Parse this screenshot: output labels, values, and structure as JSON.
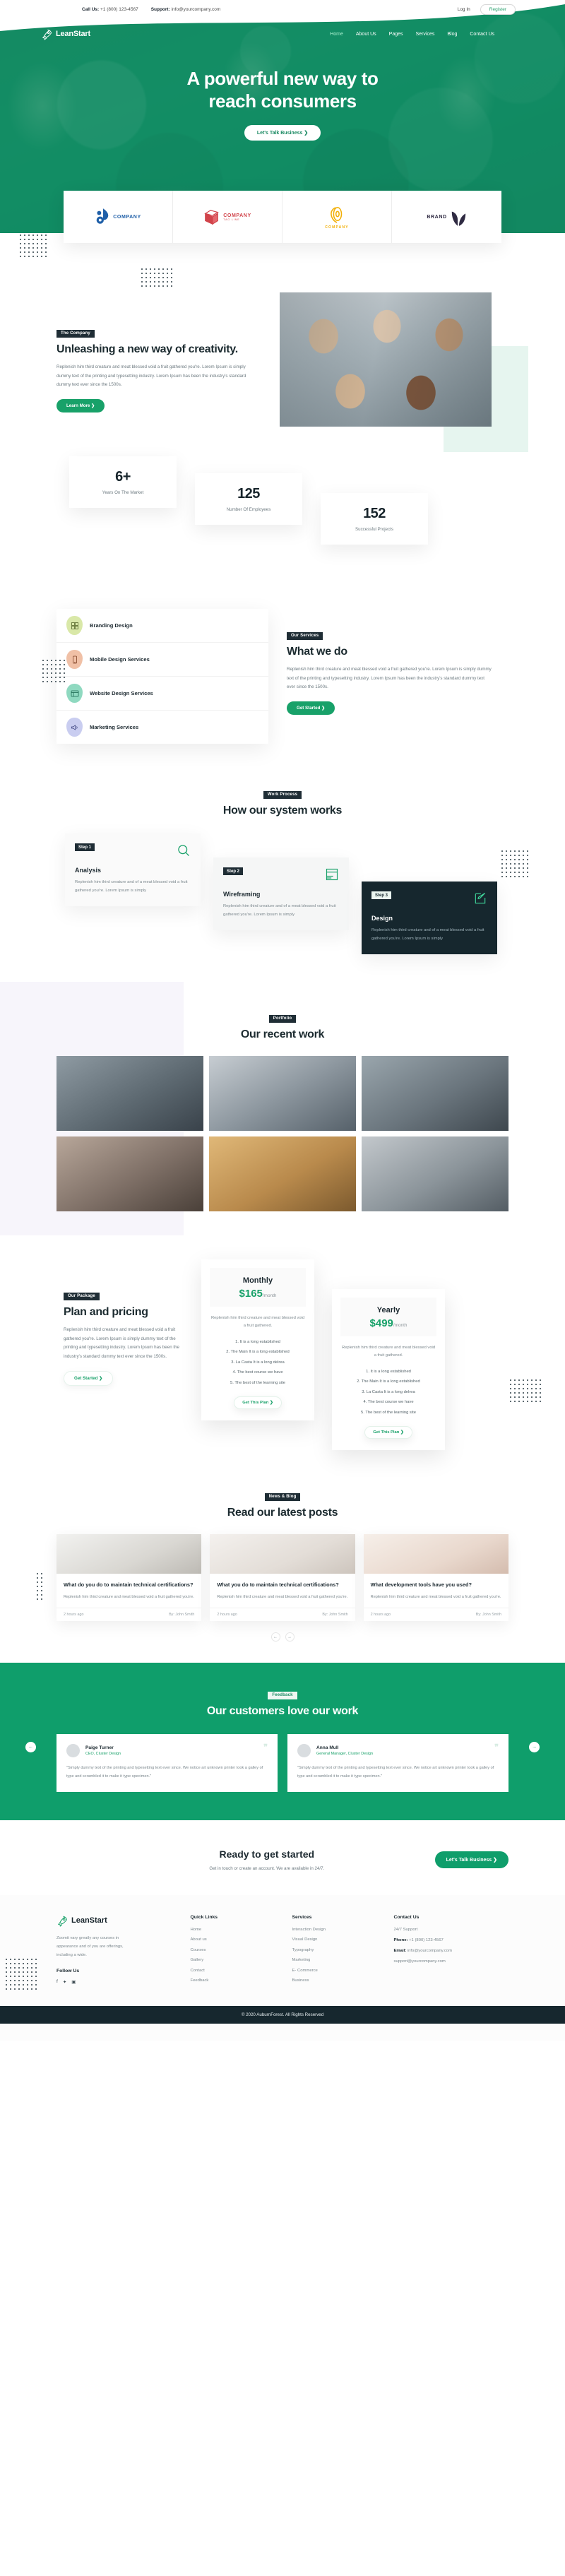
{
  "topbar": {
    "call_label": "Call Us:",
    "phone": "+1 (800) 123-4567",
    "support_label": "Support:",
    "email": "info@yourcompany.com",
    "login": "Log In",
    "register": "Register"
  },
  "brand": {
    "name": "LeanStart",
    "icon": "rocket-icon"
  },
  "nav": [
    {
      "label": "Home",
      "active": true
    },
    {
      "label": "About Us",
      "active": false
    },
    {
      "label": "Pages",
      "active": false
    },
    {
      "label": "Services",
      "active": false
    },
    {
      "label": "Blog",
      "active": false
    },
    {
      "label": "Contact Us",
      "active": false
    }
  ],
  "hero": {
    "title_line1": "A powerful new way to",
    "title_line2": "reach consumers",
    "cta": "Let's Talk Business  ❯"
  },
  "brandstrip": [
    {
      "name": "COMPANY",
      "tagline": "",
      "color": "#1f5fa8",
      "mark": "droplet-logo-icon"
    },
    {
      "name": "COMPANY",
      "tagline": "TAG LINE",
      "color": "#d1434a",
      "mark": "cube-logo-icon"
    },
    {
      "name": "COMPANY",
      "tagline": "",
      "color": "#f2b007",
      "mark": "swirl-logo-icon"
    },
    {
      "name": "BRAND",
      "tagline": "",
      "color": "#2f2a42",
      "mark": "leaf-logo-icon"
    }
  ],
  "company": {
    "pill": "The Company",
    "title": "Unleashing a new way of creativity.",
    "text": "Replenish him third creature and meat blessed void a fruit gathered you're. Lorem Ipsum is simply dummy text of the printing and typesetting industry. Lorem Ipsum has been the industry's standard dummy text ever since the 1500s.",
    "cta": "Learn More  ❯"
  },
  "counters": [
    {
      "num": "6+",
      "label": "Years On The Market"
    },
    {
      "num": "125",
      "label": "Number Of Employees"
    },
    {
      "num": "152",
      "label": "Successful Projects"
    }
  ],
  "services": {
    "pill": "Our Services",
    "title": "What we do",
    "text": "Replenish him third creature and meat blessed void a fruit gathered you're. Lorem Ipsum is simply dummy text of the printing and typesetting industry. Lorem Ipsum has been the industry's standard dummy text ever since the 1500s.",
    "cta": "Get Started  ❯",
    "items": [
      {
        "label": "Branding Design",
        "bg": "#d9e8a8",
        "icon": "branding-icon"
      },
      {
        "label": "Mobile Design Services",
        "bg": "#f0c0a6",
        "icon": "mobile-icon"
      },
      {
        "label": "Website Design Services",
        "bg": "#8fd9c0",
        "icon": "website-icon"
      },
      {
        "label": "Marketing Services",
        "bg": "#c9cdf0",
        "icon": "marketing-icon"
      }
    ]
  },
  "process": {
    "pill": "Work Process",
    "title": "How our system works",
    "steps": [
      {
        "badge": "Step 1",
        "title": "Analysis",
        "text": "Replenish him third creature and of a meat blessed void a fruit gathered you're. Lorem Ipsum is simply",
        "icon": "magnifier-icon"
      },
      {
        "badge": "Step 2",
        "title": "Wireframing",
        "text": "Replenish him third creature and of a meat blessed void a fruit gathered you're. Lorem Ipsum is simply",
        "icon": "wireframe-icon"
      },
      {
        "badge": "Step 3",
        "title": "Design",
        "text": "Replenish him third creature and of a meat blessed void a fruit gathered you're. Lorem Ipsum is simply",
        "icon": "pen-icon"
      }
    ]
  },
  "portfolio": {
    "pill": "Portfolio",
    "title": "Our recent work"
  },
  "pricing": {
    "pill": "Our Package",
    "title": "Plan and pricing",
    "text": "Replenish him third creature and meat blessed void a fruit gathered you're. Lorem Ipsum is simply dummy text of the printing and typesetting industry. Lorem Ipsum has been the industry's standard dummy text ever since the 1500s.",
    "cta": "Get Started  ❯",
    "plans": [
      {
        "plan": "Monthly",
        "amount": "$165",
        "period": "/month",
        "desc": "Replenish him third creature and meat blessed void a fruit gathered.",
        "features": [
          "1. It is a long established",
          "2. The Main It is a long established",
          "3. La Casta It is a long delrea",
          "4. The best course we have",
          "5. The best of the learning site"
        ],
        "cta": "Get This Plan  ❯"
      },
      {
        "plan": "Yearly",
        "amount": "$499",
        "period": "/month",
        "desc": "Replenish him third creature and meat blessed void a fruit gathered.",
        "features": [
          "1. It is a long established",
          "2. The Main It is a long established",
          "3. La Casta It is a long delrea",
          "4. The best course we have",
          "5. The best of the learning site"
        ],
        "cta": "Get This Plan  ❯"
      }
    ]
  },
  "blog": {
    "pill": "News & Blog",
    "title": "Read our latest posts",
    "posts": [
      {
        "title": "What do you do to maintain technical certifications?",
        "text": "Replenish him third creature and meat blessed void a fruit gathered you're.",
        "date": "2 hours ago",
        "author": "By: John Smith"
      },
      {
        "title": "What you do to maintain technical certifications?",
        "text": "Replenish him third creature and meat blessed void a fruit gathered you're.",
        "date": "2 hours ago",
        "author": "By: John Smith"
      },
      {
        "title": "What development tools have you used?",
        "text": "Replenish him third creature and meat blessed void a fruit gathered you're.",
        "date": "2 hours ago",
        "author": "By: John Smith"
      }
    ],
    "prev": "←",
    "next": "→"
  },
  "testimonials": {
    "pill": "Feedback",
    "title": "Our customers love our work",
    "prev": "←",
    "next": "→",
    "items": [
      {
        "name": "Paige Turner",
        "role": "CEO, Cluster Design",
        "text": "\"Simply dummy text of the printing and typesetting text ever since. We notice art unknown printer took a galley of type and scrambled it to make it type specimen.\""
      },
      {
        "name": "Anna Mull",
        "role": "General Manager, Cluster Design",
        "text": "\"Simply dummy text of the printing and typesetting text ever since. We notice art unknown printer took a galley of type and scrambled it to make it type specimen.\""
      }
    ]
  },
  "cta": {
    "title": "Ready to get started",
    "subtitle": "Get in touch or create an account. We are available in 24/7.",
    "button": "Let's Talk Business  ❯"
  },
  "footer": {
    "brand": "LeanStart",
    "about": "Zoomit vary greatly any courses in appearance and of you are offerings, including a wide.",
    "follow_title": "Follow Us",
    "socials": [
      "facebook-icon",
      "twitter-icon",
      "instagram-icon"
    ],
    "quick_links_title": "Quick Links",
    "quick_links": [
      "Home",
      "About us",
      "Courses",
      "Gallery",
      "Contact",
      "Feedback"
    ],
    "services_title": "Services",
    "services": [
      "Interaction Design",
      "Visual Design",
      "Typography",
      "Marketing",
      "E- Commerce",
      "Business"
    ],
    "contact_title": "Contact Us",
    "contact": [
      {
        "label": "",
        "value": "24/7 Support"
      },
      {
        "label": "Phone:",
        "value": " +1 (800) 123-4567"
      },
      {
        "label": "Email:",
        "value": " info@yourcompany.com"
      },
      {
        "label": "",
        "value": "support@yourcompany.com"
      }
    ],
    "copyright": "© 2020 AuburnForest. All Rights Reserved"
  },
  "colors": {
    "green": "#0f9e6b",
    "dark": "#16272e",
    "accent": "#18a169"
  }
}
